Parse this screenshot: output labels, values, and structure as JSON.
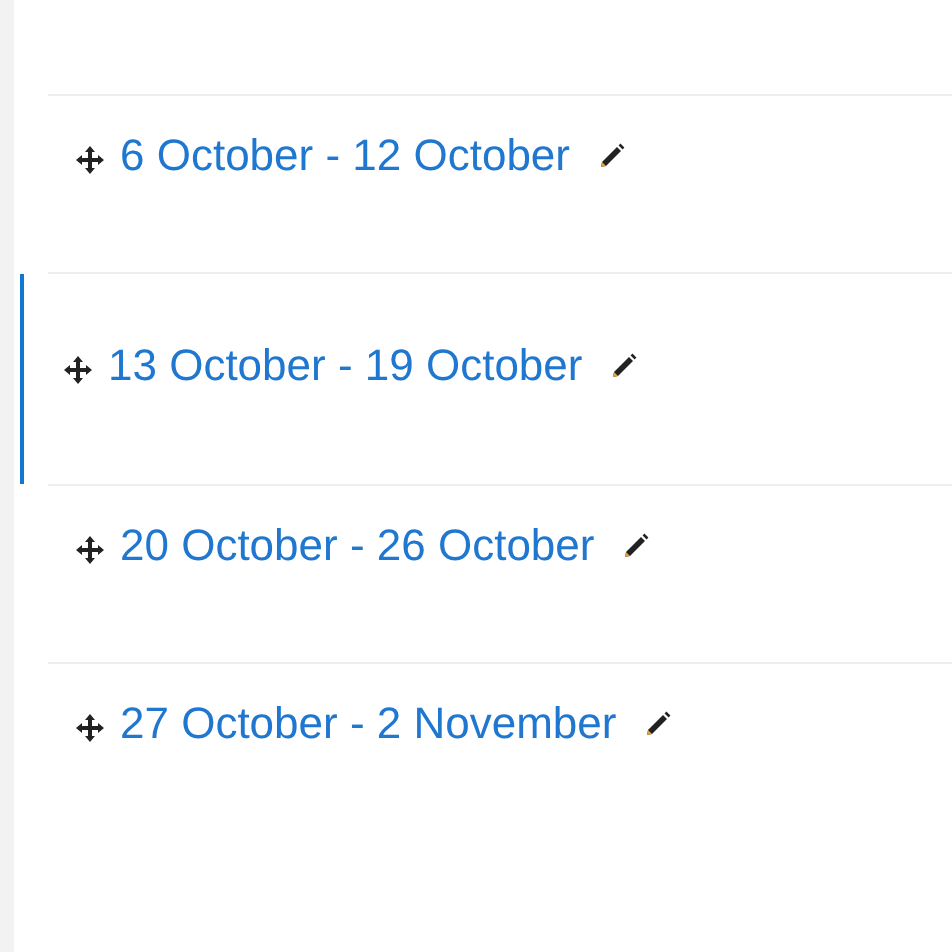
{
  "sections": [
    {
      "title": "6 October - 12 October",
      "current": false
    },
    {
      "title": "13 October - 19 October",
      "current": true
    },
    {
      "title": "20 October - 26 October",
      "current": false
    },
    {
      "title": "27 October - 2 November",
      "current": false
    }
  ]
}
